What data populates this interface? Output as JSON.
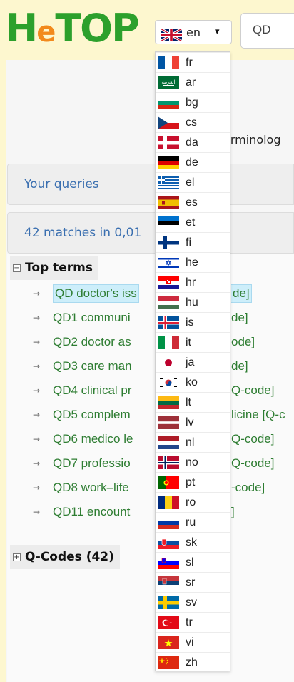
{
  "header": {
    "logo": {
      "h": "H",
      "e": "e",
      "top": "TOP"
    },
    "lang_select": {
      "code": "en",
      "flag": "gb",
      "chevron": "▾"
    },
    "search": {
      "value": "QD"
    }
  },
  "background_text": {
    "terminology": "erminolog"
  },
  "panels": {
    "queries": "Your queries",
    "matches": "42 matches in 0,01"
  },
  "tree": {
    "top_terms": {
      "pm": "−",
      "label": "Top terms"
    },
    "items": [
      {
        "label": "QD doctor's iss",
        "tail": "de]"
      },
      {
        "label": "QD1 communi",
        "tail": "de]"
      },
      {
        "label": "QD2 doctor as",
        "tail": "ode]"
      },
      {
        "label": "QD3 care man",
        "tail": "de]"
      },
      {
        "label": "QD4 clinical pr",
        "tail": "Q-code]"
      },
      {
        "label": "QD5 complem",
        "tail": "licine [Q-c"
      },
      {
        "label": "QD6 medico le",
        "tail": "Q-code]"
      },
      {
        "label": "QD7 professio",
        "tail": "Q-code]"
      },
      {
        "label": "QD8 work–life",
        "tail": "-code]"
      },
      {
        "label": "QD11 encount",
        "tail": "]"
      }
    ],
    "qcodes": {
      "pm": "+",
      "label": "Q-Codes (42)"
    }
  },
  "languages": [
    {
      "code": "fr",
      "flag": "fr"
    },
    {
      "code": "ar",
      "flag": "ar"
    },
    {
      "code": "bg",
      "flag": "bg"
    },
    {
      "code": "cs",
      "flag": "cs"
    },
    {
      "code": "da",
      "flag": "da"
    },
    {
      "code": "de",
      "flag": "de"
    },
    {
      "code": "el",
      "flag": "el"
    },
    {
      "code": "es",
      "flag": "es"
    },
    {
      "code": "et",
      "flag": "et"
    },
    {
      "code": "fi",
      "flag": "fi"
    },
    {
      "code": "he",
      "flag": "he"
    },
    {
      "code": "hr",
      "flag": "hr"
    },
    {
      "code": "hu",
      "flag": "hu"
    },
    {
      "code": "is",
      "flag": "is"
    },
    {
      "code": "it",
      "flag": "it"
    },
    {
      "code": "ja",
      "flag": "ja"
    },
    {
      "code": "ko",
      "flag": "ko"
    },
    {
      "code": "lt",
      "flag": "lt"
    },
    {
      "code": "lv",
      "flag": "lv"
    },
    {
      "code": "nl",
      "flag": "nl"
    },
    {
      "code": "no",
      "flag": "no"
    },
    {
      "code": "pt",
      "flag": "pt"
    },
    {
      "code": "ro",
      "flag": "ro"
    },
    {
      "code": "ru",
      "flag": "ru"
    },
    {
      "code": "sk",
      "flag": "sk"
    },
    {
      "code": "sl",
      "flag": "sl"
    },
    {
      "code": "sr",
      "flag": "sr"
    },
    {
      "code": "sv",
      "flag": "sv"
    },
    {
      "code": "tr",
      "flag": "tr"
    },
    {
      "code": "vi",
      "flag": "vi"
    },
    {
      "code": "zh",
      "flag": "zh"
    }
  ],
  "colors": {
    "brand_green": "#2ca02c",
    "brand_orange": "#f28a1c",
    "link_blue": "#3a6fb0",
    "term_green": "#2e7d32",
    "highlight": "#cdeefa"
  }
}
